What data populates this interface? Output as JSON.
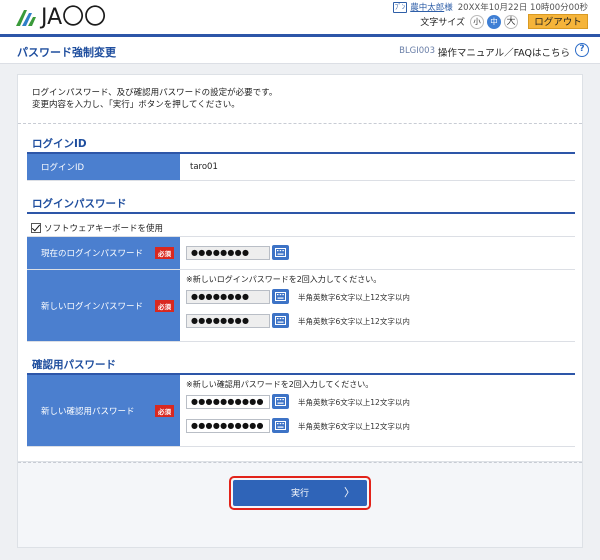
{
  "header": {
    "logo_text": "JA〇〇",
    "user_badge": "ﾌﾞﾝ",
    "user_name": "農中太郎",
    "user_sama": "様",
    "timestamp": "20XX年10月22日 10時00分00秒",
    "font_size_label": "文字サイズ",
    "font_sizes": [
      "小",
      "中",
      "大"
    ],
    "logout_label": "ログアウト"
  },
  "title_bar": {
    "title": "パスワード強制変更",
    "screen_id": "BLGI003",
    "help_link": "操作マニュアル／FAQはこちら",
    "help_icon": "?"
  },
  "intro": {
    "line1": "ログインパスワード、及び確認用パスワードの設定が必要です。",
    "line2": "変更内容を入力し、「実行」ボタンを押してください。"
  },
  "login_id_section": {
    "title": "ログインID",
    "label": "ログインID",
    "value": "taro01"
  },
  "login_pw_section": {
    "title": "ログインパスワード",
    "software_kb_label": "ソフトウェアキーボードを使用",
    "current_label": "現在のログインパスワード",
    "required": "必須",
    "current_value": "●●●●●●●●",
    "new_label": "新しいログインパスワード",
    "new_note": "※新しいログインパスワードを2回入力してください。",
    "new_value1": "●●●●●●●●",
    "new_value2": "●●●●●●●●",
    "hint": "半角英数字6文字以上12文字以内"
  },
  "confirm_pw_section": {
    "title": "確認用パスワード",
    "label": "新しい確認用パスワード",
    "required": "必須",
    "note": "※新しい確認用パスワードを2回入力してください。",
    "value1": "●●●●●●●●●●",
    "value2": "●●●●●●●●●●",
    "hint": "半角英数字6文字以上12文字以内"
  },
  "action": {
    "execute_label": "実行",
    "execute_arrow": "〉"
  },
  "colors": {
    "brand_blue": "#2d56a8",
    "label_blue": "#4b7fcf",
    "required_red": "#d9281f",
    "logout_orange": "#f5b43a",
    "highlight_red": "#e2231a"
  }
}
